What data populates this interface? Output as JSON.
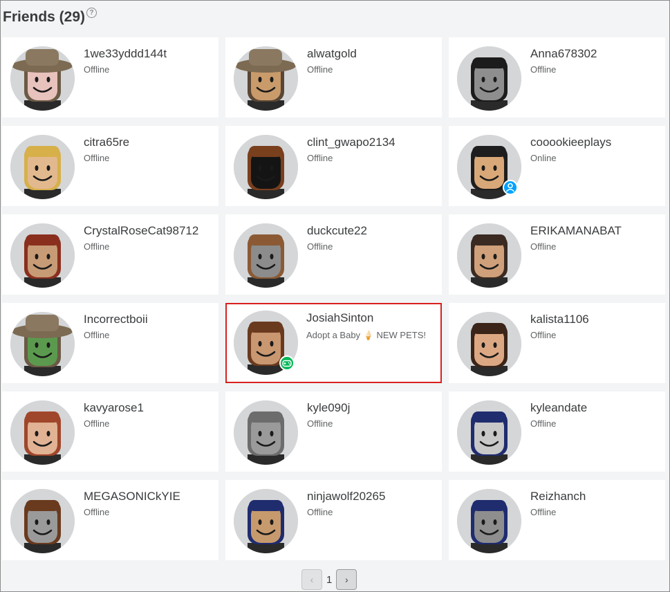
{
  "title": "Friends (29)",
  "help_glyph": "?",
  "friends": [
    {
      "name": "1we33yddd144t",
      "status": "Offline",
      "skin": "#e8c2bd",
      "hair": "#6b5a45",
      "hat": true,
      "presence": ""
    },
    {
      "name": "alwatgold",
      "status": "Offline",
      "skin": "#c99b6b",
      "hair": "#5a4634",
      "hat": true,
      "presence": ""
    },
    {
      "name": "Anna678302",
      "status": "Offline",
      "skin": "#8e8e8e",
      "hair": "#1c1c1c",
      "hat": false,
      "presence": ""
    },
    {
      "name": "citra65re",
      "status": "Offline",
      "skin": "#e2b98e",
      "hair": "#d7b04a",
      "hat": false,
      "presence": ""
    },
    {
      "name": "clint_gwapo2134",
      "status": "Offline",
      "skin": "#141414",
      "hair": "#7a3f1d",
      "hat": false,
      "presence": ""
    },
    {
      "name": "cooookieeplays",
      "status": "Online",
      "skin": "#d9a878",
      "hair": "#1e1e1e",
      "hat": false,
      "presence": "online"
    },
    {
      "name": "CrystalRoseCat98712",
      "status": "Offline",
      "skin": "#c79b76",
      "hair": "#8a2f1e",
      "hat": false,
      "presence": ""
    },
    {
      "name": "duckcute22",
      "status": "Offline",
      "skin": "#8c8c8c",
      "hair": "#8b5a34",
      "hat": false,
      "presence": ""
    },
    {
      "name": "ERIKAMANABAT",
      "status": "Offline",
      "skin": "#cfa07a",
      "hair": "#3a2a22",
      "hat": false,
      "presence": ""
    },
    {
      "name": "Incorrectboii",
      "status": "Offline",
      "skin": "#5b9a4e",
      "hair": "#6b5a45",
      "hat": true,
      "presence": ""
    },
    {
      "name": "JosiahSinton",
      "status": "Adopt a Baby 🍦 NEW PETS!",
      "skin": "#c99770",
      "hair": "#6a3a1e",
      "hat": false,
      "presence": "ingame"
    },
    {
      "name": "kalista1106",
      "status": "Offline",
      "skin": "#dca884",
      "hair": "#3b2418",
      "hat": false,
      "presence": ""
    },
    {
      "name": "kavyarose1",
      "status": "Offline",
      "skin": "#e2b294",
      "hair": "#a0462a",
      "hat": false,
      "presence": ""
    },
    {
      "name": "kyle090j",
      "status": "Offline",
      "skin": "#9a9a9a",
      "hair": "#6c6c6c",
      "hat": false,
      "presence": ""
    },
    {
      "name": "kyleandate",
      "status": "Offline",
      "skin": "#c8c8c8",
      "hair": "#1f2c6e",
      "hat": false,
      "presence": ""
    },
    {
      "name": "MEGASONICkYIE",
      "status": "Offline",
      "skin": "#9a9a9a",
      "hair": "#6a3a1e",
      "hat": false,
      "presence": ""
    },
    {
      "name": "ninjawolf20265",
      "status": "Offline",
      "skin": "#c79a6d",
      "hair": "#1f2c6e",
      "hat": false,
      "presence": ""
    },
    {
      "name": "Reizhanch",
      "status": "Offline",
      "skin": "#8e8e8e",
      "hair": "#1f2c6e",
      "hat": false,
      "presence": ""
    }
  ],
  "pager": {
    "page": "1",
    "prev_glyph": "‹",
    "next_glyph": "›"
  },
  "colors": {
    "highlight": "#d9201e",
    "online": "#00a2ff",
    "ingame": "#02b757"
  }
}
